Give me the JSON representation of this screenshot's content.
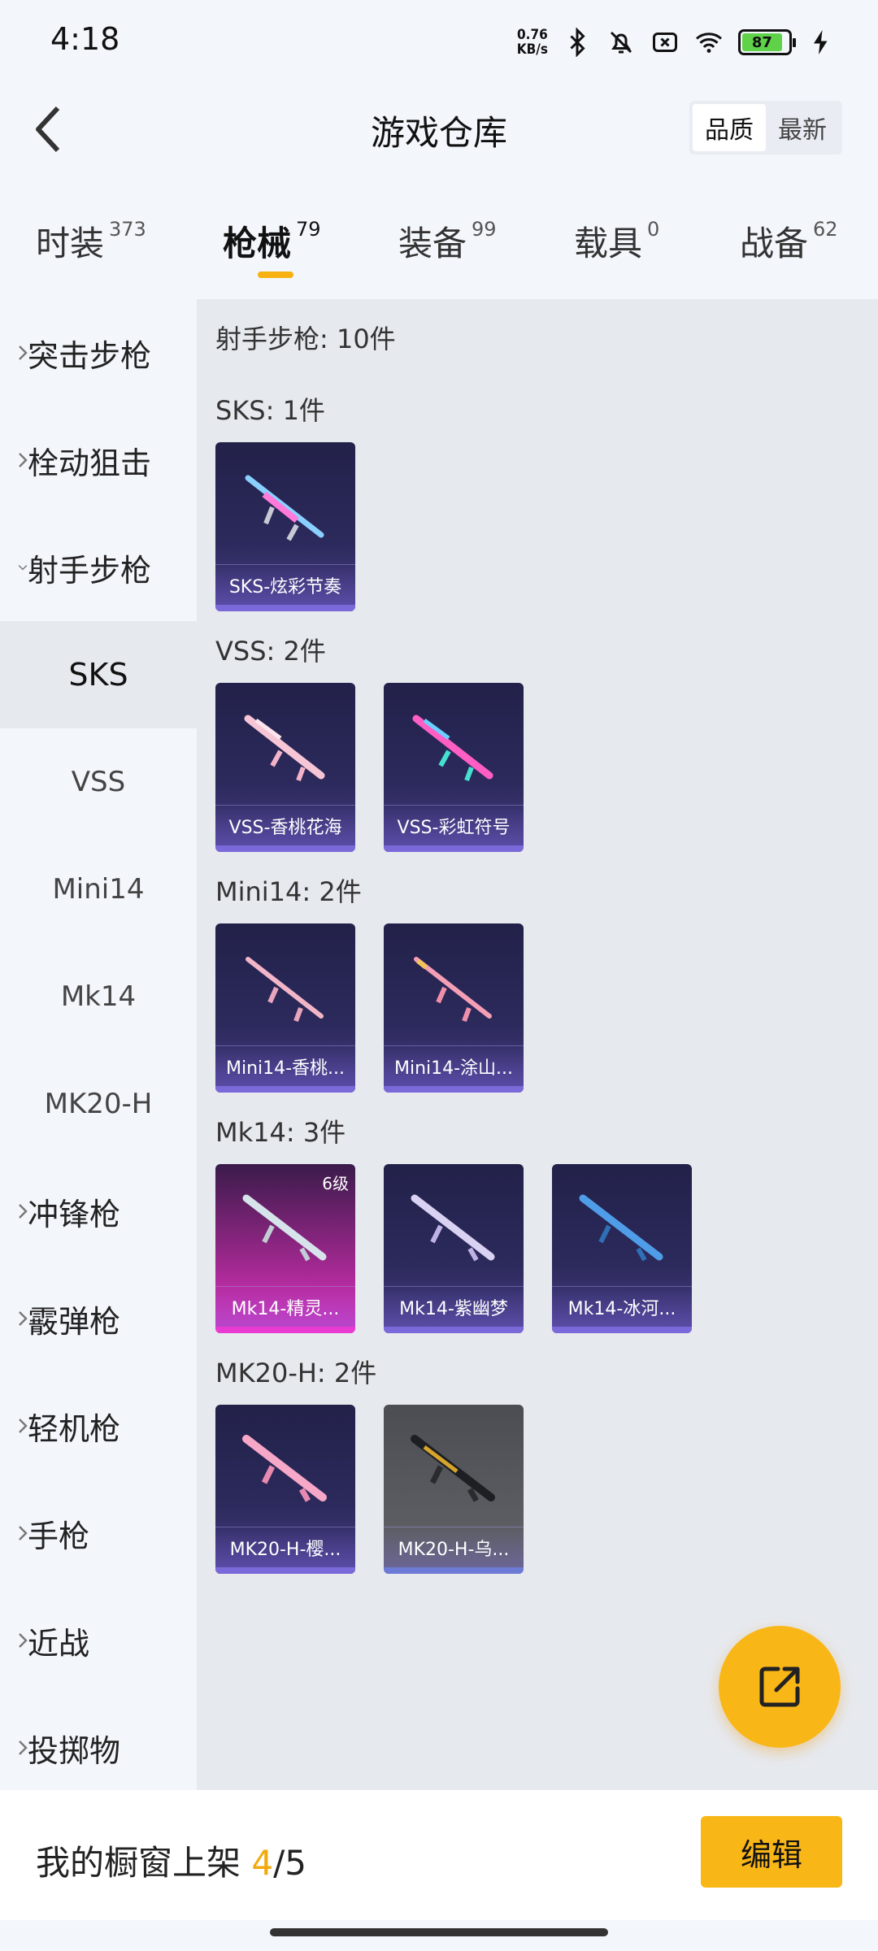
{
  "status_bar": {
    "time": "4:18",
    "net_speed_value": "0.76",
    "net_speed_unit": "KB/s",
    "battery": "87",
    "icons": [
      "bluetooth-icon",
      "bell-muted-icon",
      "sim-off-icon",
      "wifi-icon",
      "battery-icon",
      "charging-icon"
    ]
  },
  "header": {
    "title": "游戏仓库",
    "sort_options": [
      "品质",
      "最新"
    ],
    "active_sort": "品质"
  },
  "category_tabs": [
    {
      "label": "时装",
      "count": "373"
    },
    {
      "label": "枪械",
      "count": "79",
      "active": true
    },
    {
      "label": "装备",
      "count": "99"
    },
    {
      "label": "载具",
      "count": "0"
    },
    {
      "label": "战备",
      "count": "62"
    }
  ],
  "sidebar": {
    "groups": [
      {
        "label": "突击步枪",
        "expanded": false
      },
      {
        "label": "栓动狙击",
        "expanded": false
      },
      {
        "label": "射手步枪",
        "expanded": true
      },
      {
        "label": "冲锋枪",
        "expanded": false
      },
      {
        "label": "霰弹枪",
        "expanded": false
      },
      {
        "label": "轻机枪",
        "expanded": false
      },
      {
        "label": "手枪",
        "expanded": false
      },
      {
        "label": "近战",
        "expanded": false
      },
      {
        "label": "投掷物",
        "expanded": false
      }
    ],
    "sub_items": [
      "SKS",
      "VSS",
      "Mini14",
      "Mk14",
      "MK20-H"
    ],
    "active_sub": "SKS"
  },
  "content": {
    "header": "射手步枪: 10件",
    "sections": [
      {
        "title": "SKS: 1件",
        "items": [
          {
            "name": "SKS-炫彩节奏",
            "quality": "purple"
          }
        ]
      },
      {
        "title": "VSS: 2件",
        "items": [
          {
            "name": "VSS-香桃花海",
            "quality": "purple"
          },
          {
            "name": "VSS-彩虹符号",
            "quality": "purple"
          }
        ]
      },
      {
        "title": "Mini14: 2件",
        "items": [
          {
            "name": "Mini14-香桃...",
            "quality": "purple"
          },
          {
            "name": "Mini14-涂山...",
            "quality": "purple"
          }
        ]
      },
      {
        "title": "Mk14: 3件",
        "items": [
          {
            "name": "Mk14-精灵...",
            "quality": "pink",
            "level": "6级"
          },
          {
            "name": "Mk14-紫幽梦",
            "quality": "purple"
          },
          {
            "name": "Mk14-冰河...",
            "quality": "purple"
          }
        ]
      },
      {
        "title": "MK20-H: 2件",
        "items": [
          {
            "name": "MK20-H-樱...",
            "quality": "purple"
          },
          {
            "name": "MK20-H-乌...",
            "quality": "grey"
          }
        ]
      }
    ]
  },
  "showcase": {
    "label": "我的橱窗上架",
    "current": "4",
    "total": "/5",
    "edit_label": "编辑"
  },
  "colors": {
    "accent": "#f9b617",
    "purple_card": "#2c2a5c",
    "pink_card": "#e236c5",
    "grey_card": "#5b5d63"
  }
}
